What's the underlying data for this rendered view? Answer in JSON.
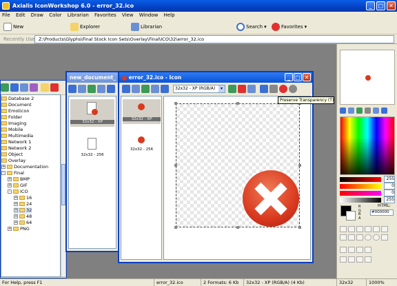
{
  "app": {
    "title": "Axialis IconWorkshop 6.0 - error_32.ico"
  },
  "menu": [
    "File",
    "Edit",
    "Draw",
    "Color",
    "Librarian",
    "Favorites",
    "View",
    "Window",
    "Help"
  ],
  "toolbar": {
    "new_label": "New",
    "explorer_label": "Explorer",
    "librarian_label": "Librarian",
    "search_label": "Search",
    "favorites_label": "Favorites"
  },
  "pathbar": {
    "label": "Recently Used",
    "path": "Z:\\Products\\Glyphs\\Final Stock Icon Sets\\Overlay\\Final\\ICO\\32\\error_32.ico"
  },
  "tree": {
    "items": [
      "Database 2",
      "Document",
      "Emoticon",
      "Folder",
      "Imaging",
      "Mobile",
      "Multimedia",
      "Network 1",
      "Network 2",
      "Object",
      "Overlay",
      "Documentation",
      "Final",
      "BMP",
      "GIF",
      "ICO",
      "16",
      "24",
      "32",
      "48",
      "64",
      "PNG"
    ]
  },
  "doc_window": {
    "title": "new_document_",
    "formats": [
      "32x32 - XP",
      "32x32 - 256"
    ]
  },
  "icon_window": {
    "title": "error_32.ico - Icon",
    "format_select": "32x32 - XP (RGB/A)",
    "tooltip": "Preserve Transparency (T)",
    "formats": [
      "32x32 - XP",
      "32x32 - 256"
    ]
  },
  "color_panel": {
    "values": [
      "255",
      "0",
      "0",
      "255"
    ],
    "html_label": "HTML:",
    "html_value": "#000000",
    "r": "R",
    "g": "G",
    "b": "B",
    "a": "A"
  },
  "status": {
    "help": "For Help, press F1",
    "file": "error_32.ico",
    "formats": "2 Formats: 6 Kb",
    "size": "32x32 - XP (RGB/A) (4 Kb)",
    "grid": "32x32",
    "zoom": "1000%"
  },
  "colors": {
    "accent": "#0a52d8",
    "icon_red": "#d93a1f"
  }
}
